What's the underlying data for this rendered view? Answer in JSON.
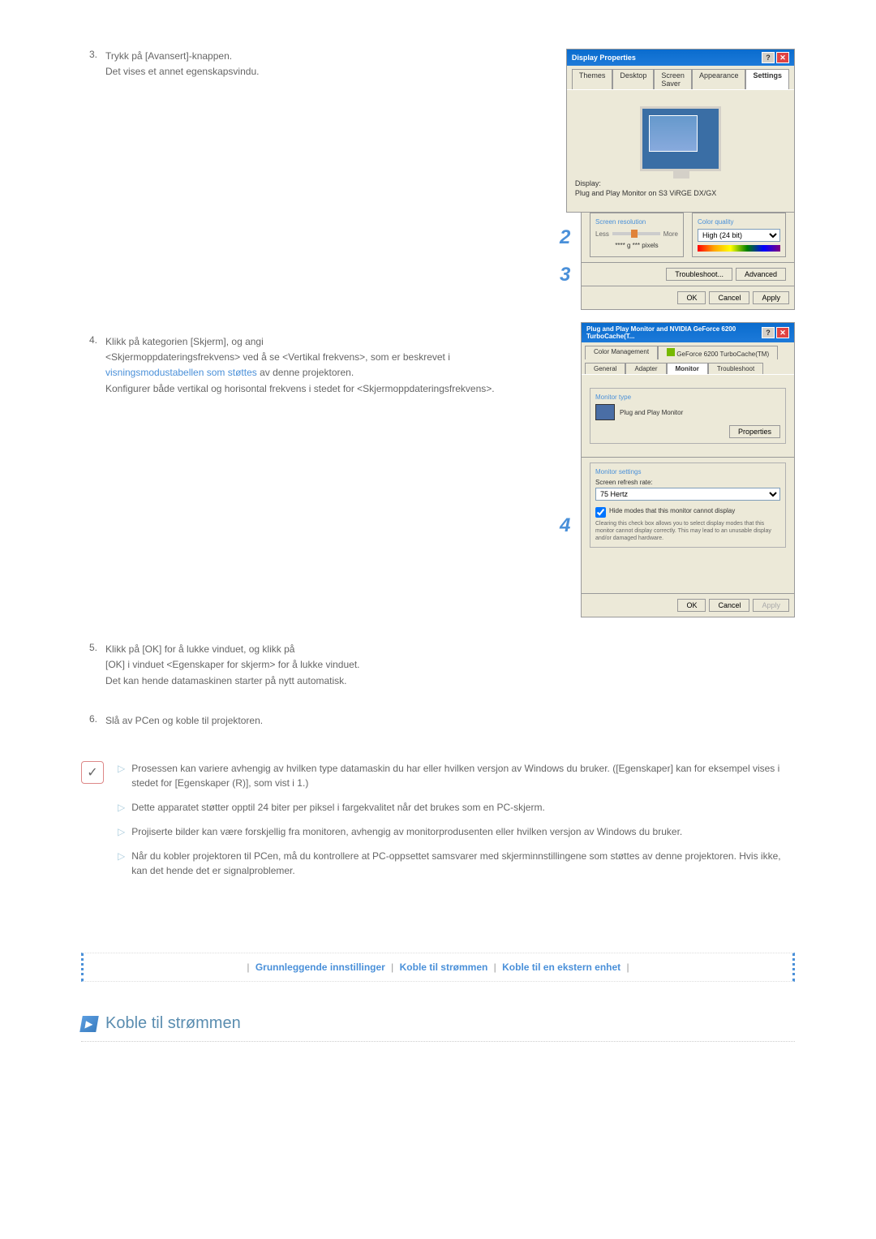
{
  "steps": {
    "s3": {
      "num": "3.",
      "line1": "Trykk på [Avansert]-knappen.",
      "line2": "Det vises et annet egenskapsvindu."
    },
    "s4": {
      "num": "4.",
      "line1": "Klikk på kategorien [Skjerm], og angi",
      "line2": "<Skjermoppdateringsfrekvens> ved å se <Vertikal frekvens>, som er beskrevet i ",
      "link": "visningsmodustabellen som støttes",
      "line2b": " av denne projektoren.",
      "line3": "Konfigurer både vertikal og horisontal frekvens i stedet for <Skjermoppdateringsfrekvens>."
    },
    "s5": {
      "num": "5.",
      "line1": "Klikk på [OK] for å lukke vinduet, og klikk på",
      "line2": "[OK] i vinduet <Egenskaper for skjerm> for å lukke vinduet.",
      "line3": "Det kan hende datamaskinen starter på nytt automatisk."
    },
    "s6": {
      "num": "6.",
      "line1": "Slå av PCen og koble til projektoren."
    }
  },
  "dialog1": {
    "title": "Display Properties",
    "tabs": {
      "themes": "Themes",
      "desktop": "Desktop",
      "saver": "Screen Saver",
      "appearance": "Appearance",
      "settings": "Settings"
    },
    "display_label": "Display:",
    "display_name": "Plug and Play Monitor on S3 ViRGE DX/GX",
    "resolution": {
      "title": "Screen resolution",
      "less": "Less",
      "more": "More",
      "pixels": "**** g *** pixels"
    },
    "quality": {
      "title": "Color quality",
      "value": "High (24 bit)"
    },
    "troubleshoot": "Troubleshoot...",
    "advanced": "Advanced",
    "ok": "OK",
    "cancel": "Cancel",
    "apply": "Apply"
  },
  "dialog2": {
    "title": "Plug and Play Monitor and NVIDIA GeForce 6200 TurboCache(T...",
    "tabs": {
      "colormgmt": "Color Management",
      "nvidia": "GeForce 6200 TurboCache(TM)",
      "general": "General",
      "adapter": "Adapter",
      "monitor": "Monitor",
      "troubleshoot": "Troubleshoot"
    },
    "monitor_type": "Monitor type",
    "monitor_name": "Plug and Play Monitor",
    "properties": "Properties",
    "settings_title": "Monitor settings",
    "refresh_label": "Screen refresh rate:",
    "refresh_value": "75 Hertz",
    "hide_modes": "Hide modes that this monitor cannot display",
    "hide_desc": "Clearing this check box allows you to select display modes that this monitor cannot display correctly. This may lead to an unusable display and/or damaged hardware.",
    "ok": "OK",
    "cancel": "Cancel",
    "apply": "Apply"
  },
  "badges": {
    "b2": "2",
    "b3": "3",
    "b4": "4"
  },
  "notes": {
    "n1": "Prosessen kan variere avhengig av hvilken type datamaskin du har eller hvilken versjon av Windows du bruker. ([Egenskaper] kan for eksempel vises i stedet for [Egenskaper (R)], som vist i 1.)",
    "n2": "Dette apparatet støtter opptil 24 biter per piksel i fargekvalitet når det brukes som en PC-skjerm.",
    "n3": "Projiserte bilder kan være forskjellig fra monitoren, avhengig av monitorprodusenten eller hvilken versjon av Windows du bruker.",
    "n4": "Når du kobler projektoren til PCen, må du kontrollere at PC-oppsettet samsvarer med skjerminnstillingene som støttes av denne projektoren. Hvis ikke, kan det hende det er signalproblemer."
  },
  "nav": {
    "sep": "|",
    "link1": "Grunnleggende innstillinger",
    "link2": "Koble til strømmen",
    "link3": "Koble til en ekstern enhet"
  },
  "section": {
    "title": "Koble til strømmen"
  }
}
